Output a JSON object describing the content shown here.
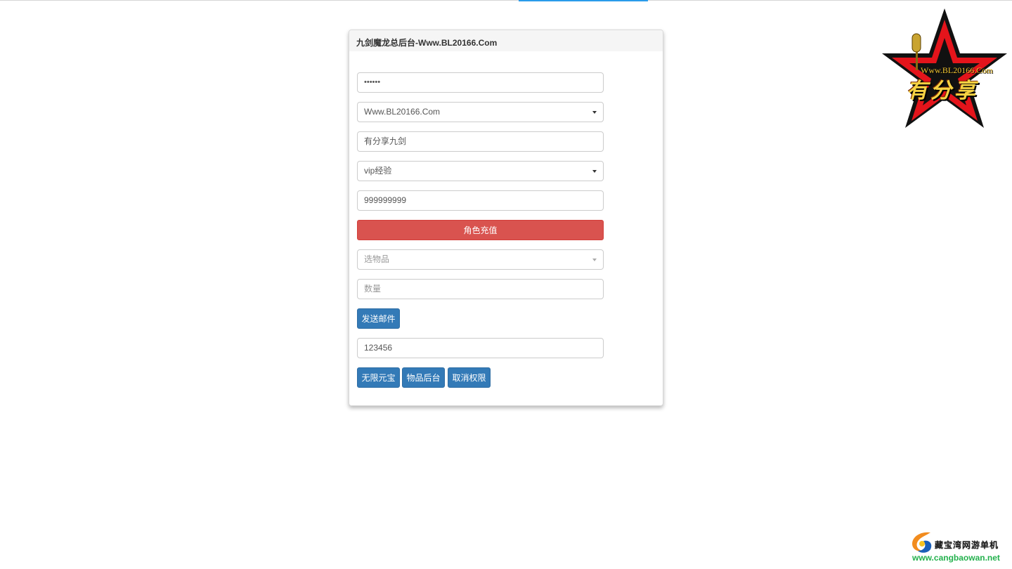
{
  "panel": {
    "title": "九剑魔龙总后台-Www.BL20166.Com"
  },
  "form": {
    "password_value": "••••••",
    "server_select": "Www.BL20166.Com",
    "role_name_value": "有分享九剑",
    "recharge_type_select": "vip经验",
    "amount_value": "999999999",
    "recharge_button": "角色充值",
    "item_select_placeholder": "选物品",
    "quantity_placeholder": "数量",
    "send_mail_button": "发送邮件",
    "code_value": "123456",
    "unlimited_yuanbao_button": "无限元宝",
    "item_backend_button": "物品后台",
    "cancel_permission_button": "取消权限"
  },
  "logos": {
    "star_url": "Www.BL20166.Com",
    "star_brand": "有分享",
    "cangbao_name": "藏宝湾网游单机",
    "cangbao_url": "www.cangbaowan.net"
  },
  "colors": {
    "danger": "#d9534f",
    "primary": "#337ab7",
    "accent": "#2a9bea"
  }
}
